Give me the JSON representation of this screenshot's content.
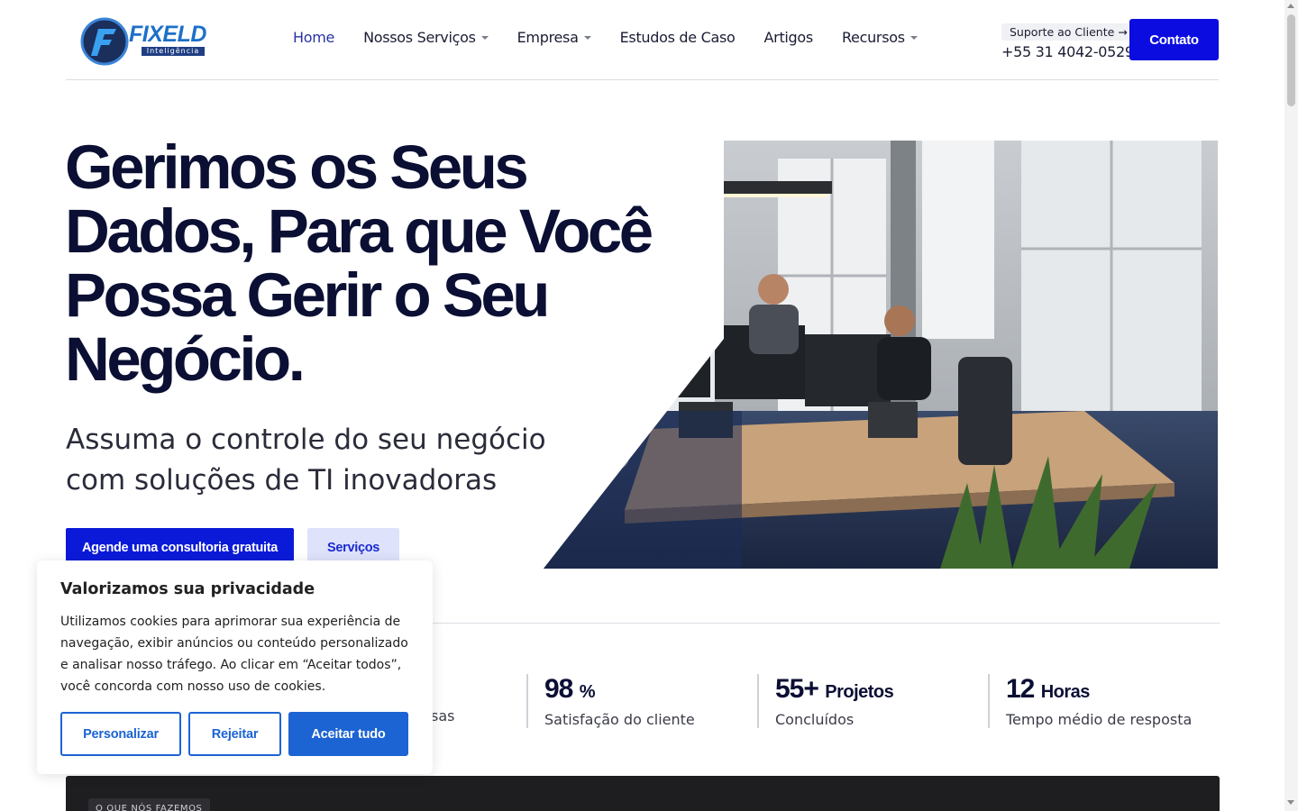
{
  "header": {
    "logo_text": "FIXELD",
    "logo_sub": "Inteligência",
    "nav": [
      {
        "label": "Home"
      },
      {
        "label": "Nossos Serviços"
      },
      {
        "label": "Empresa"
      },
      {
        "label": "Estudos de Caso"
      },
      {
        "label": "Artigos"
      },
      {
        "label": "Recursos"
      }
    ],
    "support_label": "Suporte ao Cliente →",
    "phone": "+55 31 4042-0529",
    "contact_button": "Contato"
  },
  "hero": {
    "title": "Gerimos os Seus Dados, Para que Você Possa Gerir o Seu Negócio.",
    "subtitle": "Assuma o controle do seu negócio com soluções de TI inovadoras",
    "primary_button": "Agende uma consultoria gratuita",
    "secondary_button": "Serviços"
  },
  "stats": [
    {
      "value": "98",
      "unit": "%",
      "label": "Satisfação do cliente"
    },
    {
      "value": "55+",
      "unit": "Projetos",
      "label": "Concluídos"
    },
    {
      "value": "12",
      "unit": "Horas",
      "label": "Tempo médio de resposta"
    }
  ],
  "stats_partial_label": "sas",
  "section": {
    "tag": "O QUE NÓS FAZEMOS"
  },
  "cookie": {
    "title": "Valorizamos sua privacidade",
    "text": "Utilizamos cookies para aprimorar sua experiência de navegação, exibir anúncios ou conteúdo personalizado e analisar nosso tráfego. Ao clicar em “Aceitar todos”, você concorda com nosso uso de cookies.",
    "customize_button": "Personalizar",
    "reject_button": "Rejeitar",
    "accept_button": "Aceitar tudo"
  },
  "colors": {
    "brand_blue": "#0b0ce0",
    "heading": "#0b0f33",
    "cookie_blue": "#1c63d3"
  }
}
